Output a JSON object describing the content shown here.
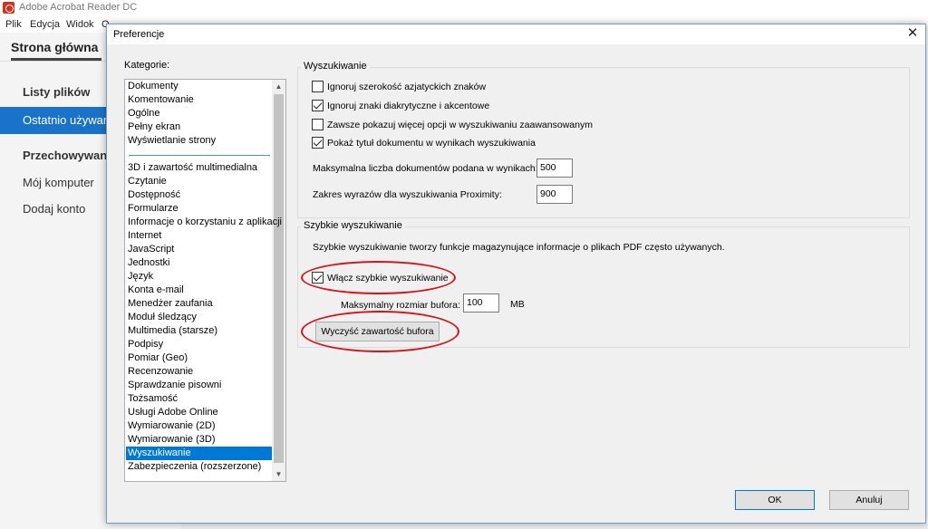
{
  "app": {
    "title": "Adobe Acrobat Reader DC",
    "menu": [
      "Plik",
      "Edycja",
      "Widok",
      "O"
    ]
  },
  "left_pane": {
    "home_tab": "Strona główna",
    "files_header": "Listy plików",
    "recent": "Ostatnio używane",
    "storage_header": "Przechowywanie",
    "my_computer": "Mój komputer",
    "add_account": "Dodaj konto"
  },
  "dialog": {
    "title": "Preferencje",
    "categories_label": "Kategorie:",
    "categories_top": [
      "Dokumenty",
      "Komentowanie",
      "Ogólne",
      "Pełny ekran",
      "Wyświetlanie strony"
    ],
    "categories": [
      "3D i zawartość multimedialna",
      "Czytanie",
      "Dostępność",
      "Formularze",
      "Informacje o korzystaniu z aplikacji",
      "Internet",
      "JavaScript",
      "Jednostki",
      "Język",
      "Konta e-mail",
      "Menedżer zaufania",
      "Moduł śledzący",
      "Multimedia (starsze)",
      "Podpisy",
      "Pomiar (Geo)",
      "Recenzowanie",
      "Sprawdzanie pisowni",
      "Tożsamość",
      "Usługi Adobe Online",
      "Wymiarowanie (2D)",
      "Wymiarowanie (3D)",
      "Wyszukiwanie",
      "Zabezpieczenia (rozszerzone)"
    ],
    "selected_category": "Wyszukiwanie",
    "search": {
      "title": "Wyszukiwanie",
      "options": [
        {
          "label": "Ignoruj szerokość azjatyckich znaków",
          "checked": false
        },
        {
          "label": "Ignoruj znaki diakrytyczne i akcentowe",
          "checked": true
        },
        {
          "label": "Zawsze pokazuj więcej opcji w wyszukiwaniu zaawansowanym",
          "checked": false
        },
        {
          "label": "Pokaż tytuł dokumentu w wynikach wyszukiwania",
          "checked": true
        }
      ],
      "max_docs_label": "Maksymalna liczba dokumentów podana w wynikach:",
      "max_docs_value": "500",
      "proximity_label": "Zakres wyrazów dla wyszukiwania Proximity:",
      "proximity_value": "900"
    },
    "fast_search": {
      "title": "Szybkie wyszukiwanie",
      "description": "Szybkie wyszukiwanie tworzy funkcje magazynujące informacje o plikach PDF często używanych.",
      "enable_label": "Włącz szybkie wyszukiwanie",
      "enable_checked": true,
      "cache_label": "Maksymalny rozmiar bufora:",
      "cache_value": "100",
      "cache_unit": "MB",
      "clear_button": "Wyczyść zawartość bufora"
    },
    "ok_button": "OK",
    "cancel_button": "Anuluj"
  },
  "colors": {
    "selection": "#0078d7",
    "left_active": "#1a73c8",
    "annotation": "#d4141c"
  }
}
